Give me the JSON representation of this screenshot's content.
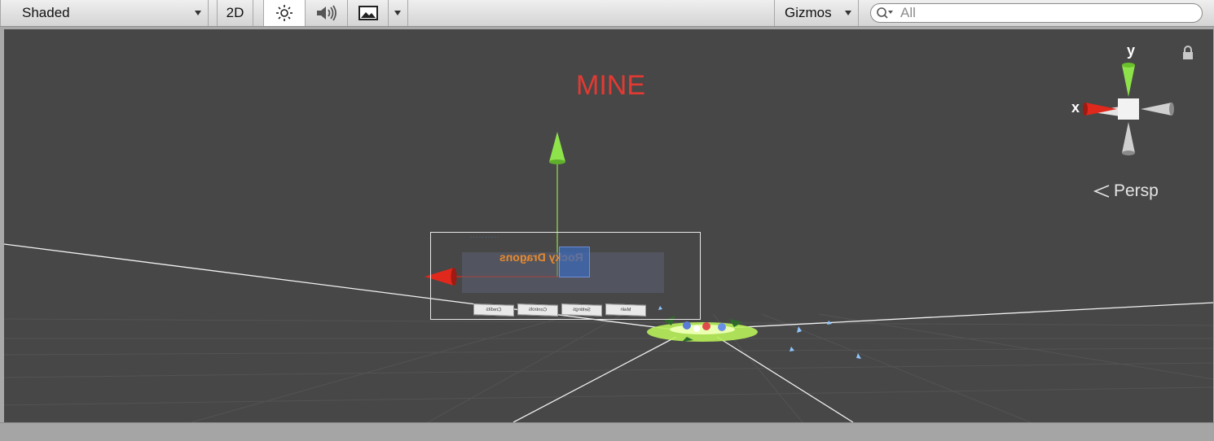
{
  "toolbar": {
    "shading_mode": "Shaded",
    "mode_2d_label": "2D",
    "scene_lighting_icon": "sun-icon",
    "scene_audio_icon": "speaker-icon",
    "effects_icon": "image-icon",
    "gizmos_label": "Gizmos",
    "search_placeholder": "All"
  },
  "viewport": {
    "world_label": "MINE",
    "projection_label": "Persp",
    "gizmo_axes": {
      "y": "y",
      "x": "x"
    },
    "ui_canvas": {
      "title": "Rocky Dragons",
      "buttons": [
        "Credits",
        "Controls",
        "Settings",
        "Main"
      ]
    }
  },
  "colors": {
    "viewport_bg": "#474747",
    "x_axis": "#e0281c",
    "y_axis": "#8fe34a",
    "label_red": "#e23a32",
    "selection": "#3c6ab8"
  }
}
